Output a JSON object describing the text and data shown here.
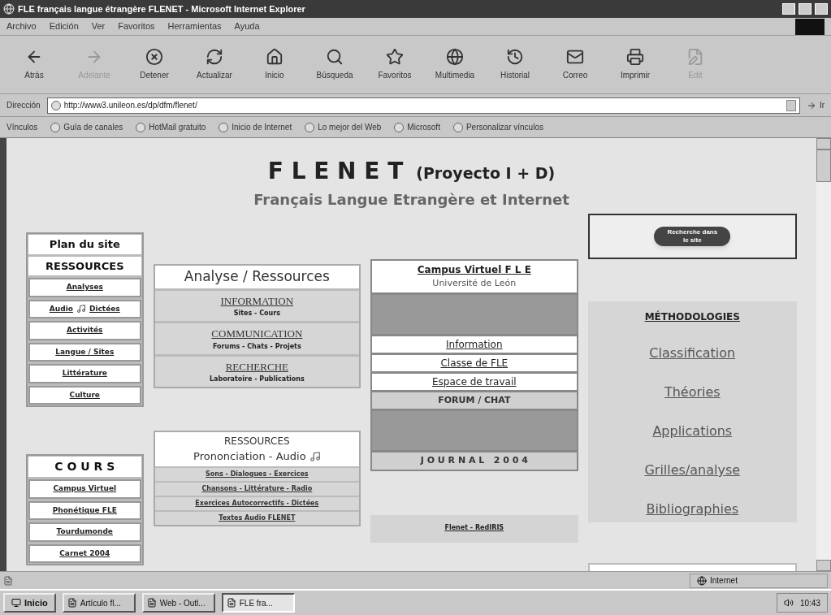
{
  "window": {
    "title": "FLE français langue étrangère FLENET - Microsoft Internet Explorer"
  },
  "menu": [
    "Archivo",
    "Edición",
    "Ver",
    "Favoritos",
    "Herramientas",
    "Ayuda"
  ],
  "toolbar": [
    {
      "label": "Atrás",
      "disabled": false
    },
    {
      "label": "Adelante",
      "disabled": true
    },
    {
      "label": "Detener",
      "disabled": false
    },
    {
      "label": "Actualizar",
      "disabled": false
    },
    {
      "label": "Inicio",
      "disabled": false
    },
    {
      "label": "Búsqueda",
      "disabled": false
    },
    {
      "label": "Favoritos",
      "disabled": false
    },
    {
      "label": "Multimedia",
      "disabled": false
    },
    {
      "label": "Historial",
      "disabled": false
    },
    {
      "label": "Correo",
      "disabled": false
    },
    {
      "label": "Imprimir",
      "disabled": false
    },
    {
      "label": "Edit",
      "disabled": true
    }
  ],
  "address": {
    "label": "Dirección",
    "value": "http://www3.unileon.es/dp/dfm/flenet/",
    "go": "Ir"
  },
  "links": {
    "label": "Vínculos",
    "items": [
      "Guía de canales",
      "HotMail gratuito",
      "Inicio de Internet",
      "Lo mejor del Web",
      "Microsoft",
      "Personalizar vínculos"
    ]
  },
  "page": {
    "title": "F L E N E T",
    "title_suffix": "(Proyecto I + D)",
    "subtitle": "Français Langue Etrangère et Internet",
    "site_menu": {
      "plan": "Plan du site",
      "heading": "RESSOURCES",
      "items": [
        {
          "text": "Analyses"
        },
        {
          "text": "Audio",
          "audio": true,
          "after": "Dictées"
        },
        {
          "text": "Activités"
        },
        {
          "text": "Langue / Sites"
        },
        {
          "text": "Littérature"
        },
        {
          "text": "Culture"
        }
      ]
    },
    "courses": {
      "heading": "C O U R S",
      "items": [
        "Campus Virtuel",
        "Phonétique FLE",
        "Tourdumonde",
        "Carnet 2004"
      ]
    },
    "analysis": {
      "heading": "Analyse / Ressources",
      "sections": [
        {
          "title": "INFORMATION",
          "sub": "Sites - Cours"
        },
        {
          "title": "COMMUNICATION",
          "sub": "Forums - Chats - Projets"
        },
        {
          "title": "RECHERCHE",
          "sub": "Laboratoire - Publications"
        }
      ]
    },
    "resources": {
      "heading": "RESSOURCES",
      "sub": "Prononciation - Audio",
      "items": [
        "Sons - Dialogues - Exercices",
        "Chansons - Littérature - Radio",
        "Exercices Autocorrectifs - Dictées",
        "Textes Audio FLENET"
      ]
    },
    "campus": {
      "title": "Campus Virtuel F L E",
      "sub": "Université de León",
      "items": [
        {
          "text": "Information",
          "kind": "link"
        },
        {
          "text": "Classe de FLE",
          "kind": "link"
        },
        {
          "text": "Espace de travail",
          "kind": "link"
        },
        {
          "text": "FORUM / CHAT",
          "kind": "header"
        },
        {
          "kind": "block"
        },
        {
          "text": "J O U R N A L   2 0 0 4",
          "kind": "header"
        }
      ]
    },
    "partner": "Flenet - RedIRIS",
    "search_button": "Recherche dans le site",
    "methods": {
      "heading": "MÉTHODOLOGIES",
      "items": [
        "Classification",
        "Théories",
        "Applications",
        "Grilles/analyse",
        "Bibliographies"
      ]
    }
  },
  "status_bar": {
    "zone": "Internet"
  },
  "taskbar": {
    "start": "Inicio",
    "windows": [
      {
        "label": "Artículo fl...",
        "selected": false
      },
      {
        "label": "Web - Outl...",
        "selected": false
      },
      {
        "label": "FLE fra...",
        "selected": true
      }
    ],
    "clock": "10:43"
  }
}
